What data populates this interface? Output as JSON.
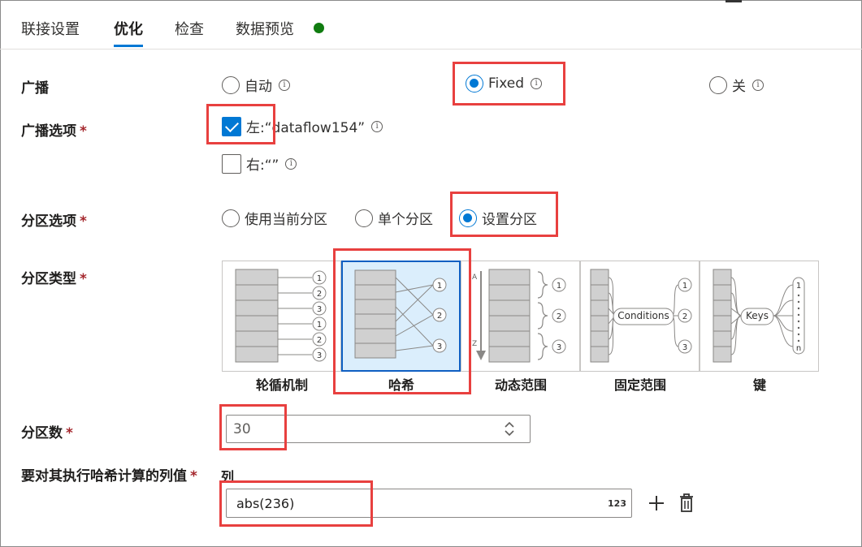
{
  "tabs": [
    {
      "label": "联接设置"
    },
    {
      "label": "优化"
    },
    {
      "label": "检查"
    },
    {
      "label": "数据预览"
    }
  ],
  "status_dot_color": "#107c10",
  "broadcast": {
    "label": "广播",
    "options": [
      "自动",
      "Fixed",
      "关"
    ],
    "selected": "Fixed"
  },
  "broadcast_options": {
    "label": "广播选项",
    "left": {
      "label": "左:“dataflow154”",
      "checked": true
    },
    "right": {
      "label": "右:“”",
      "checked": false
    }
  },
  "partition_option": {
    "label": "分区选项",
    "options": [
      "使用当前分区",
      "单个分区",
      "设置分区"
    ],
    "selected": "设置分区"
  },
  "partition_type": {
    "label": "分区类型",
    "cards": [
      {
        "caption": "轮循机制"
      },
      {
        "caption": "哈希"
      },
      {
        "caption": "动态范围"
      },
      {
        "caption": "固定范围",
        "center_label": "Conditions"
      },
      {
        "caption": "键",
        "center_label": "Keys"
      }
    ],
    "selected": "哈希"
  },
  "partition_count": {
    "label": "分区数",
    "value": "30"
  },
  "hash_columns": {
    "label": "要对其执行哈希计算的列值",
    "column_header": "列",
    "value": "abs(236)",
    "type_badge": "123"
  },
  "required_marker": "*",
  "accent_color": "#0078d4",
  "highlight_color": "#e8403f",
  "icons": [
    "info-icon",
    "checkmark-icon",
    "spinner-icon",
    "plus-icon",
    "trash-icon"
  ]
}
